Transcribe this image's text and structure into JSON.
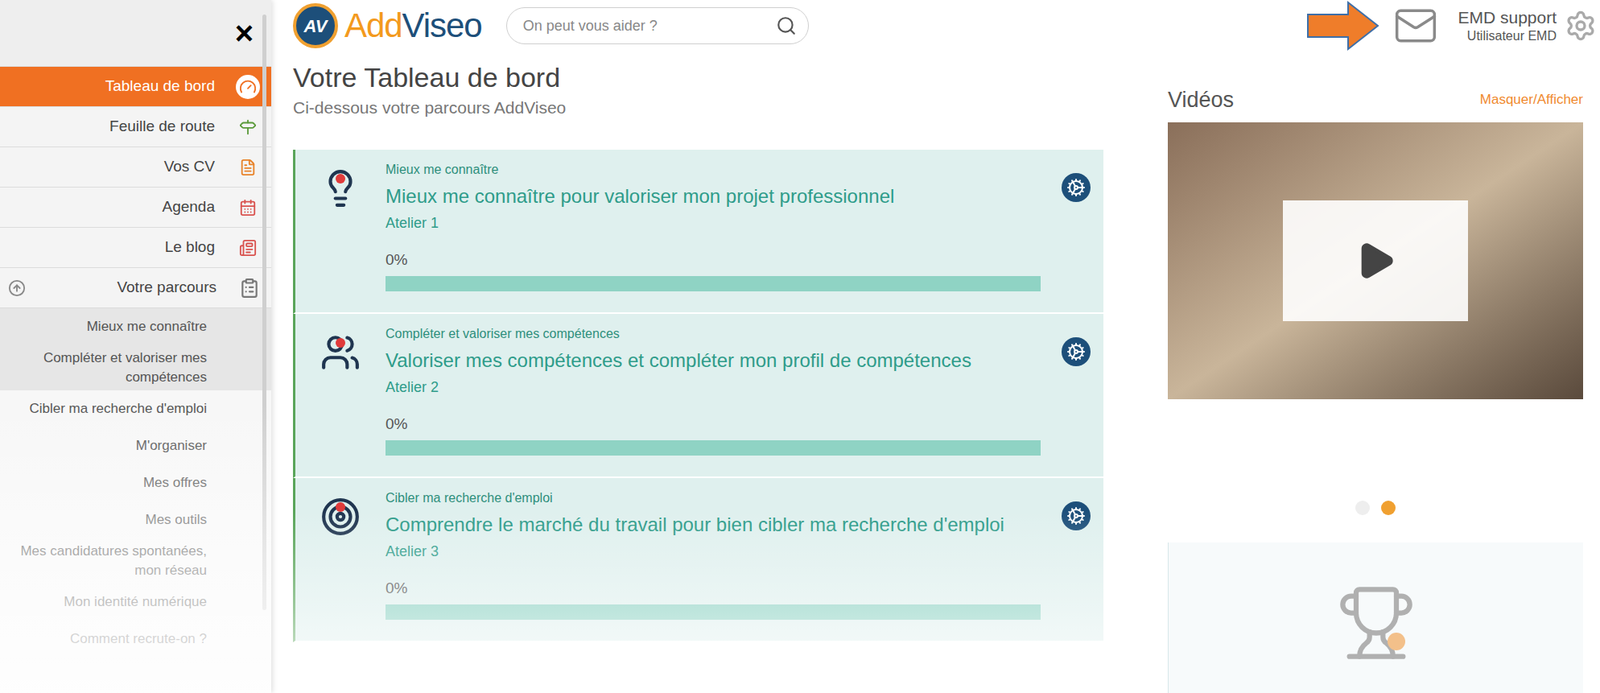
{
  "sidebar": {
    "close": "×",
    "items": [
      {
        "label": "Tableau de bord",
        "selected": true,
        "icon": "gauge"
      },
      {
        "label": "Feuille de route",
        "selected": false,
        "icon": "signpost"
      },
      {
        "label": "Vos CV",
        "selected": false,
        "icon": "cv"
      },
      {
        "label": "Agenda",
        "selected": false,
        "icon": "calendar"
      },
      {
        "label": "Le blog",
        "selected": false,
        "icon": "blog"
      }
    ],
    "parcours": {
      "label": "Votre parcours",
      "expanded": true
    },
    "subitems": [
      {
        "label": "Mieux me connaître",
        "highlighted": true
      },
      {
        "label": "Compléter et valoriser mes compétences",
        "highlighted": true
      },
      {
        "label": "Cibler ma recherche d'emploi",
        "highlighted": false
      },
      {
        "label": "M'organiser",
        "highlighted": false
      },
      {
        "label": "Mes offres",
        "highlighted": false
      },
      {
        "label": "Mes outils",
        "highlighted": false
      },
      {
        "label": "Mes candidatures spontanées, mon réseau",
        "highlighted": false
      },
      {
        "label": "Mon identité numérique",
        "highlighted": false
      },
      {
        "label": "Comment recrute-on ?",
        "highlighted": false
      }
    ]
  },
  "header": {
    "logo_mark": "AV",
    "logo_first": "Add",
    "logo_second": "Viseo",
    "search": {
      "placeholder": "On peut vous aider ?"
    },
    "user": {
      "name": "EMD support",
      "role": "Utilisateur EMD"
    }
  },
  "dashboard": {
    "title": "Votre Tableau de bord",
    "subtitle": "Ci-dessous votre parcours AddViseo",
    "cards": [
      {
        "category": "Mieux me connaître",
        "title": "Mieux me connaître pour valoriser mon projet professionnel",
        "workshop": "Atelier 1",
        "percent": "0%",
        "level": 0,
        "icon": "head"
      },
      {
        "category": "Compléter et valoriser mes compétences",
        "title": "Valoriser mes compétences et compléter mon profil de compétences",
        "workshop": "Atelier 2",
        "percent": "0%",
        "level": 0,
        "icon": "team"
      },
      {
        "category": "Cibler ma recherche d'emploi",
        "title": "Comprendre le marché du travail pour bien cibler ma recherche d'emploi",
        "workshop": "Atelier 3",
        "percent": "0%",
        "level": 0,
        "icon": "target"
      }
    ]
  },
  "videos": {
    "title": "Vidéos",
    "toggle": "Masquer/Afficher",
    "dots": [
      {
        "selected": false
      },
      {
        "selected": true
      }
    ]
  }
}
